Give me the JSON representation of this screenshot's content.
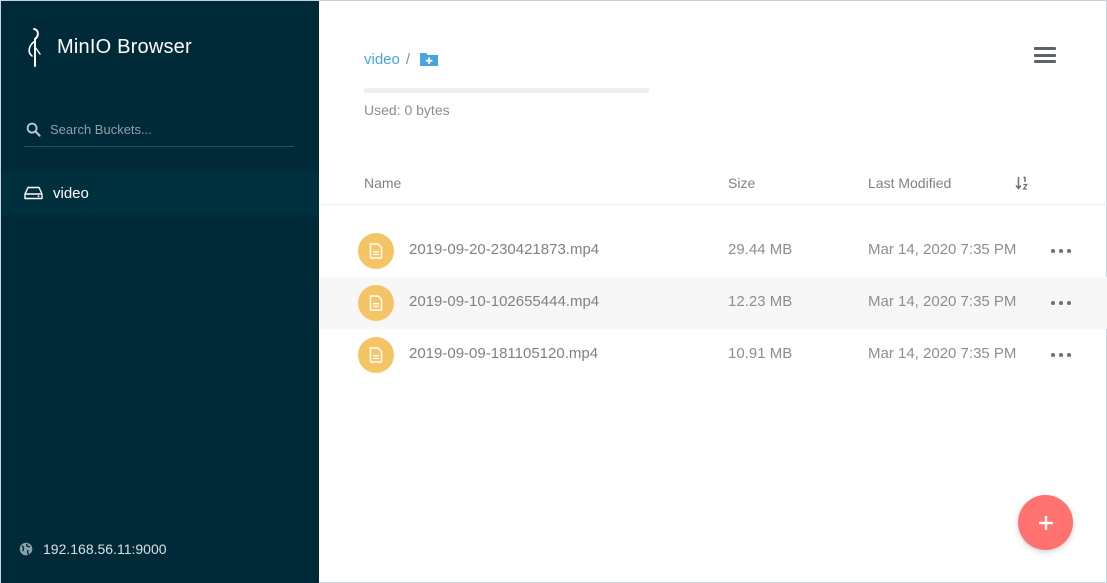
{
  "colors": {
    "sidebar_bg": "#002a37",
    "active_item_bg": "#00303e",
    "accent": "#46a5e0",
    "file_icon": "#f5c565",
    "fab": "#ff726f"
  },
  "sidebar": {
    "logo_icon": "minio-heron-icon",
    "app_title": "MinIO Browser",
    "search": {
      "placeholder": "Search Buckets..."
    },
    "buckets": [
      {
        "icon": "bucket-drive-icon",
        "label": "video",
        "active": true
      }
    ],
    "host": {
      "icon": "globe-icon",
      "text": "192.168.56.11:9000"
    }
  },
  "header": {
    "breadcrumb": {
      "bucket": "video",
      "separator": "/"
    },
    "add_folder_icon": "folder-plus-icon",
    "menu_icon": "hamburger-menu-icon"
  },
  "storage": {
    "used_fraction": 0.0,
    "used_label": "Used: 0 bytes"
  },
  "table": {
    "columns": {
      "name": "Name",
      "size": "Size",
      "last_modified": "Last Modified"
    },
    "sort_icon": "sort-icon",
    "rows": [
      {
        "name": "2019-09-20-230421873.mp4",
        "size": "29.44 MB",
        "modified": "Mar 14, 2020 7:35 PM"
      },
      {
        "name": "2019-09-10-102655444.mp4",
        "size": "12.23 MB",
        "modified": "Mar 14, 2020 7:35 PM"
      },
      {
        "name": "2019-09-09-181105120.mp4",
        "size": "10.91 MB",
        "modified": "Mar 14, 2020 7:35 PM"
      }
    ]
  },
  "fab": {
    "icon": "plus-icon"
  }
}
